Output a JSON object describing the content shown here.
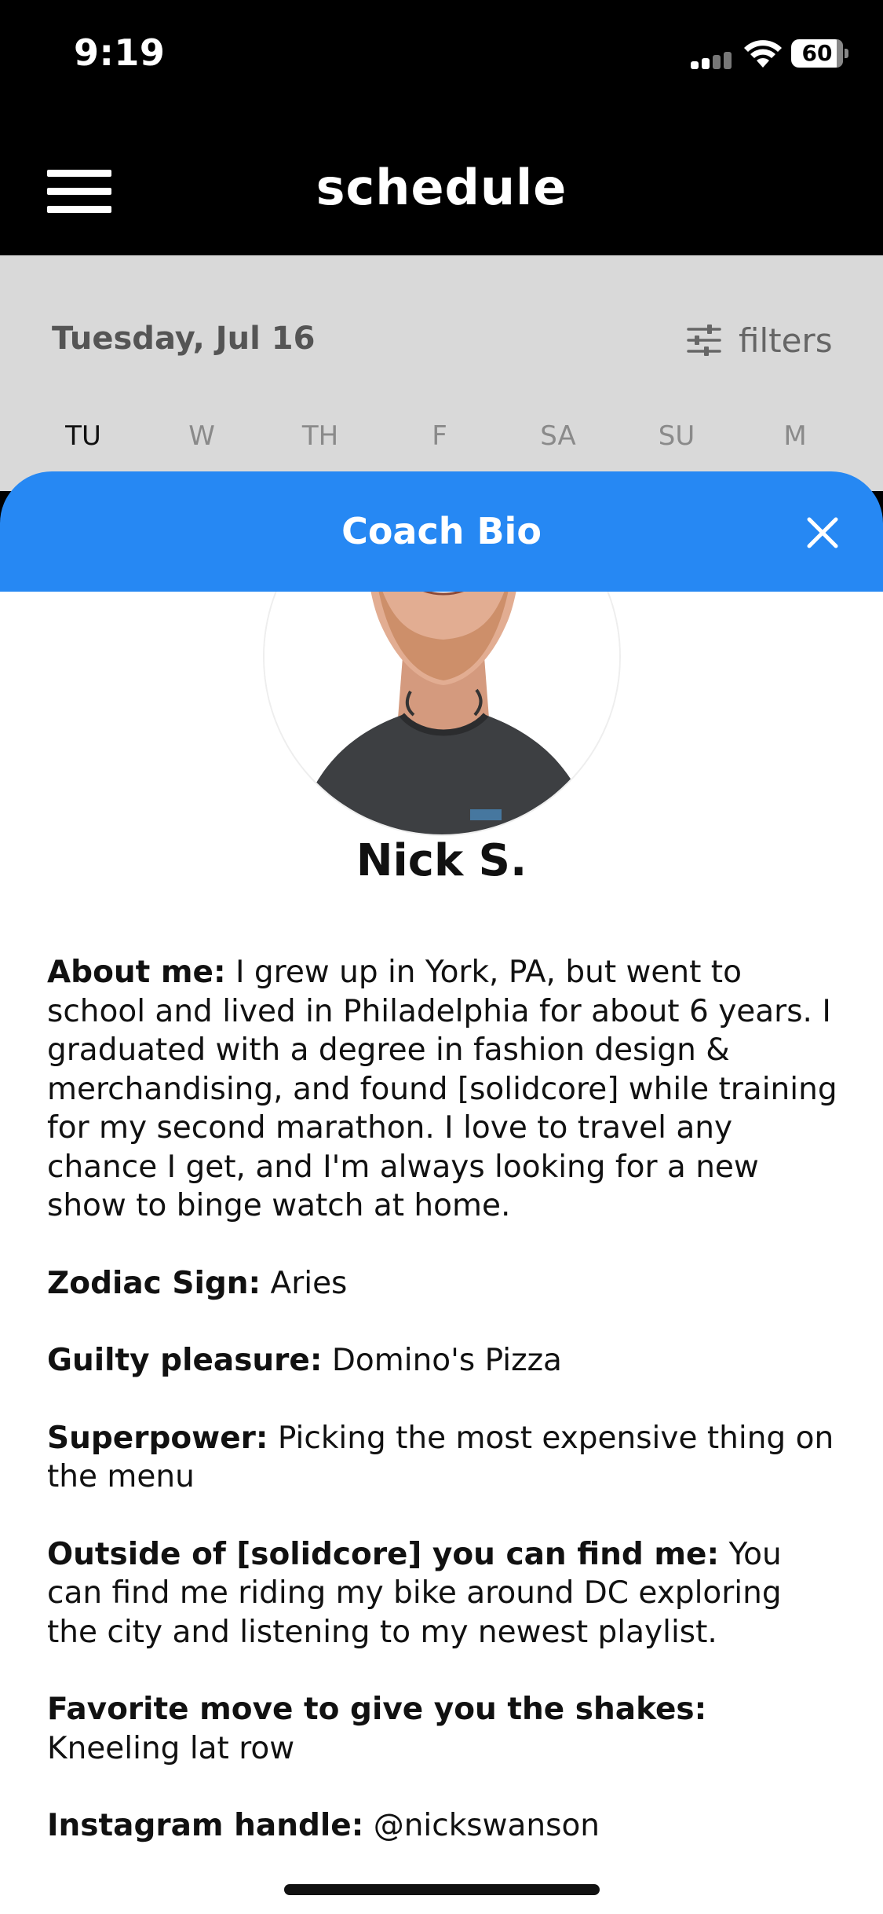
{
  "status": {
    "time": "9:19",
    "battery": "60"
  },
  "header": {
    "title": "schedule"
  },
  "schedule": {
    "date": "Tuesday, Jul 16",
    "filters_label": "filters",
    "days": [
      "TU",
      "W",
      "TH",
      "F",
      "SA",
      "SU",
      "M"
    ],
    "selected_day": "TU"
  },
  "sheet": {
    "title": "Coach Bio",
    "accent_color": "#2688f3"
  },
  "coach": {
    "name": "Nick S.",
    "bio": [
      {
        "label": "About me:",
        "text": "I grew up in York, PA, but went to school and lived in Philadelphia for about 6 years. I graduated with a degree in fashion design & merchandising, and found [solidcore] while training for my second marathon. I love to travel any chance I get, and I'm always looking for a new show to binge watch at home."
      },
      {
        "label": "Zodiac Sign:",
        "text": "Aries"
      },
      {
        "label": "Guilty pleasure:",
        "text": "Domino's Pizza"
      },
      {
        "label": "Superpower:",
        "text": "Picking the most expensive thing on the menu"
      },
      {
        "label": "Outside of [solidcore] you can find me:",
        "text": "You can find me riding my bike around DC exploring the city and listening to my newest playlist."
      },
      {
        "label": "Favorite move to give you the shakes:",
        "text": "Kneeling lat row"
      },
      {
        "label": "Instagram handle:",
        "text": "@nickswanson"
      }
    ]
  }
}
